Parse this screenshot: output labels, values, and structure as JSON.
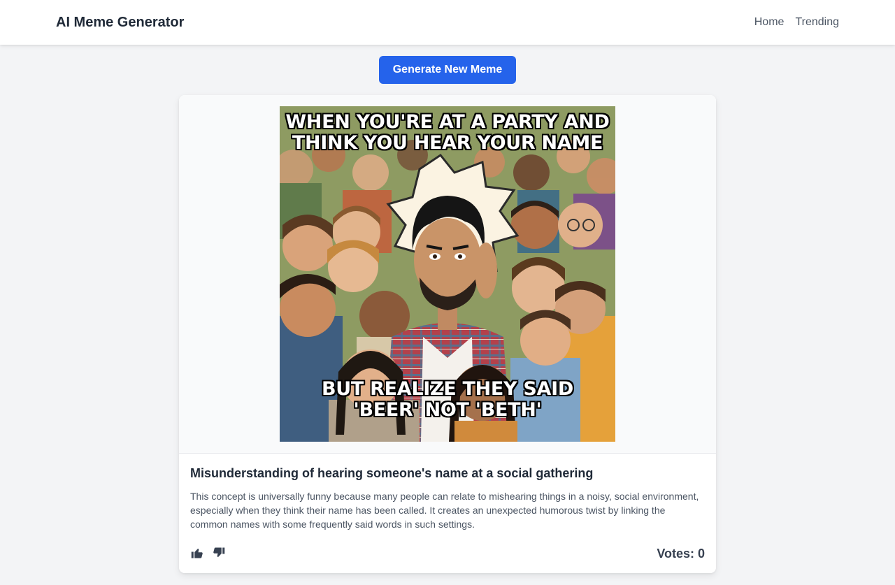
{
  "header": {
    "brand": "AI Meme Generator",
    "nav": [
      "Home",
      "Trending"
    ]
  },
  "actions": {
    "generate_label": "Generate New Meme"
  },
  "meme": {
    "top_text": "WHEN YOU'RE AT A PARTY AND\nTHINK YOU HEAR YOUR NAME",
    "bottom_text": "BUT REALIZE THEY SAID\n'BEER' NOT 'BETH'",
    "title": "Misunderstanding of hearing someone's name at a social gathering",
    "description": "This concept is universally funny because many people can relate to mishearing things in a noisy, social environment, especially when they think their name has been called. It creates an unexpected humorous twist by linking the common names with some frequently said words in such settings.",
    "votes_label": "Votes: 0"
  },
  "icons": {
    "upvote": "thumbs-up-icon",
    "downvote": "thumbs-down-icon"
  },
  "colors": {
    "primary": "#2563eb",
    "page_background": "#f3f4f6",
    "text": "#1f2937",
    "muted_text": "#4b5563"
  }
}
